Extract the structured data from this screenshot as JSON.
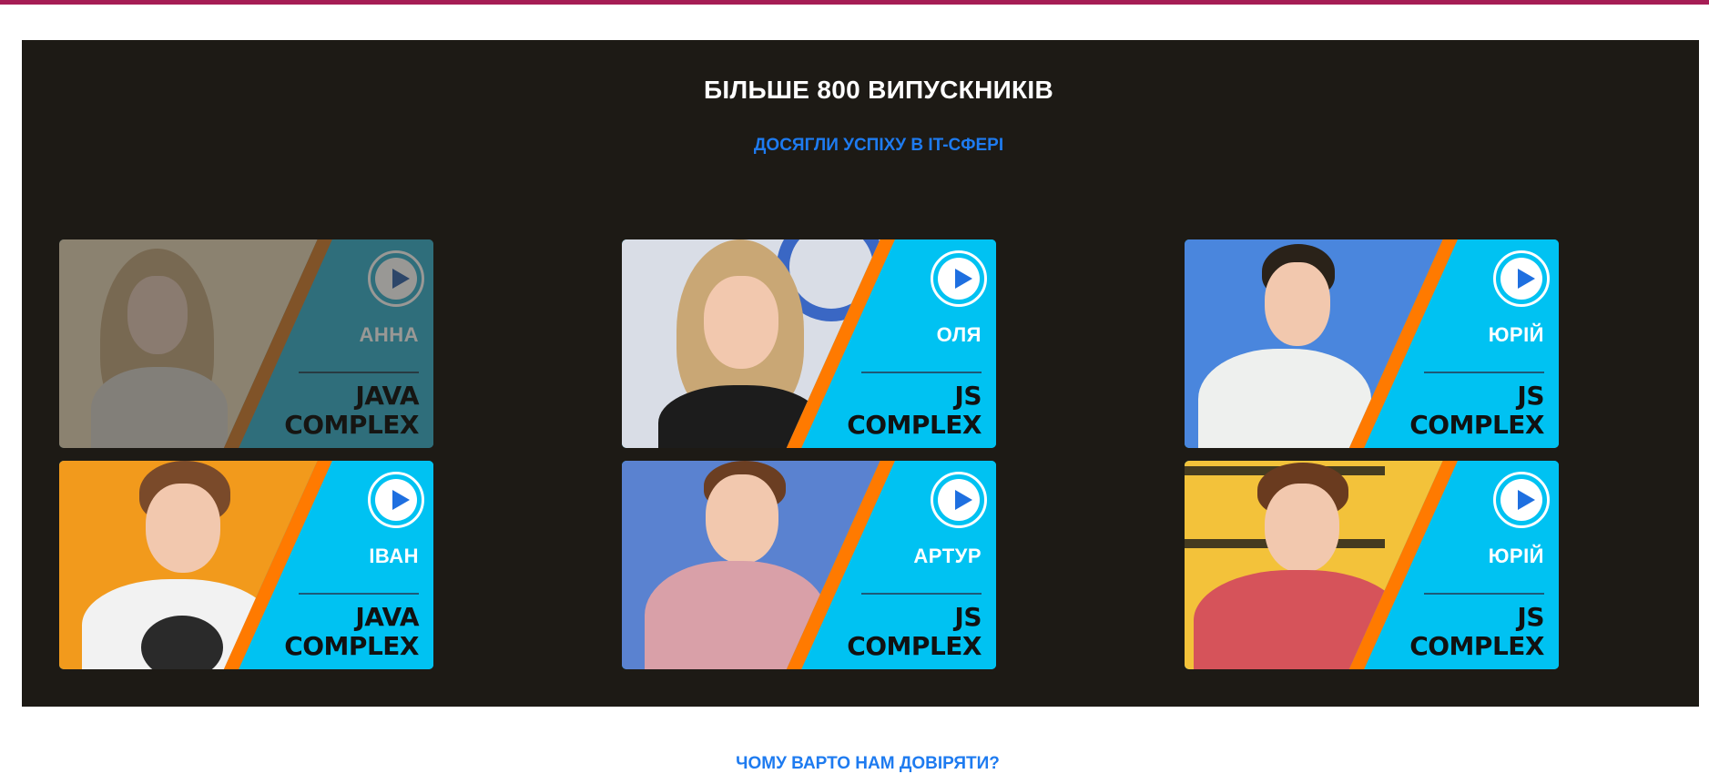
{
  "section": {
    "title": "БІЛЬШЕ 800 ВИПУСКНИКІВ",
    "subtitle": "ДОСЯГЛИ УСПІХУ В IT-СФЕРІ"
  },
  "cards": [
    {
      "name": "АННА",
      "course_line1": "JAVA",
      "course_line2": "COMPLEX",
      "photo_bg": "#f0d6a8",
      "faded": true
    },
    {
      "name": "ОЛЯ",
      "course_line1": "JS",
      "course_line2": "COMPLEX",
      "photo_bg": "#d9dde6"
    },
    {
      "name": "ЮРІЙ",
      "course_line1": "JS",
      "course_line2": "COMPLEX",
      "photo_bg": "#4a86dd"
    },
    {
      "name": "ІВАН",
      "course_line1": "JAVA",
      "course_line2": "COMPLEX",
      "photo_bg": "#f29a1c"
    },
    {
      "name": "АРТУР",
      "course_line1": "JS",
      "course_line2": "COMPLEX",
      "photo_bg": "#5a82d0"
    },
    {
      "name": "ЮРІЙ",
      "course_line1": "JS",
      "course_line2": "COMPLEX",
      "photo_bg": "#f3c23a"
    }
  ],
  "next_section_title": "ЧОМУ ВАРТО НАМ ДОВІРЯТИ?",
  "colors": {
    "accent_bar": "#a61d55",
    "panel_bg": "#1d1a15",
    "link_blue": "#1e7bf0",
    "card_blue": "#00c2f2",
    "card_stripe": "#ff7a00"
  }
}
